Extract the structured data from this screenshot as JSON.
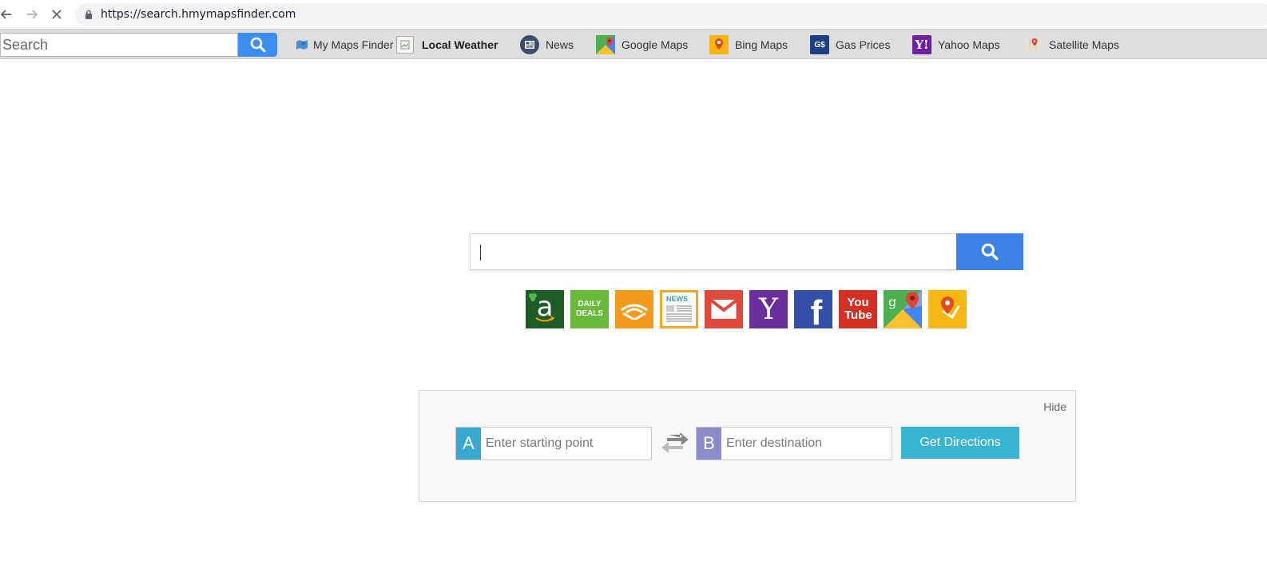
{
  "browser": {
    "url": "https://search.hmymapsfinder.com"
  },
  "toolbar": {
    "search_placeholder": "Search",
    "links": [
      {
        "label": "My Maps Finder",
        "icon": "maps-finder-icon"
      },
      {
        "label": "Local Weather",
        "icon": "broken-image-icon"
      },
      {
        "label": "News",
        "icon": "news-icon"
      },
      {
        "label": "Google Maps",
        "icon": "google-maps-icon"
      },
      {
        "label": "Bing Maps",
        "icon": "bing-maps-icon"
      },
      {
        "label": "Gas Prices",
        "icon": "gas-prices-icon"
      },
      {
        "label": "Yahoo Maps",
        "icon": "yahoo-maps-icon"
      },
      {
        "label": "Satellite Maps",
        "icon": "satellite-maps-icon"
      }
    ]
  },
  "main_search": {
    "value": ""
  },
  "tiles": [
    {
      "name": "amazon",
      "label": "a",
      "color": "#1f5d28"
    },
    {
      "name": "daily-deals",
      "label": "DAILY DEALS",
      "color": "#69b93a"
    },
    {
      "name": "audible",
      "label": "",
      "color": "#f39a1d"
    },
    {
      "name": "news",
      "label": "NEWS",
      "color": "#f5a623"
    },
    {
      "name": "gmail",
      "label": "",
      "color": "#e04a3c"
    },
    {
      "name": "yahoo",
      "label": "Y",
      "color": "#6b2e9c"
    },
    {
      "name": "facebook",
      "label": "f",
      "color": "#3350a8"
    },
    {
      "name": "youtube",
      "label": "You Tube",
      "color": "#d32f22"
    },
    {
      "name": "google-maps",
      "label": "g",
      "color": "#4caf50"
    },
    {
      "name": "bing-maps",
      "label": "",
      "color": "#f7b712"
    }
  ],
  "directions": {
    "hide_label": "Hide",
    "start_badge": "A",
    "start_placeholder": "Enter starting point",
    "dest_badge": "B",
    "dest_placeholder": "Enter destination",
    "button_label": "Get Directions",
    "start_color": "#37a9d0",
    "dest_color": "#8c8ccc"
  }
}
